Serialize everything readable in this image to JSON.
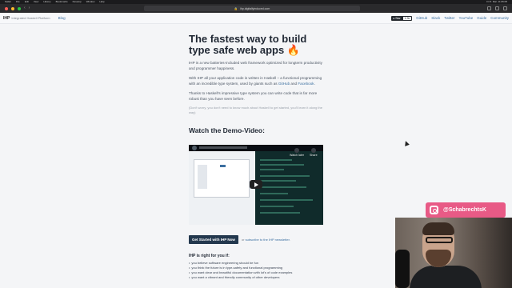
{
  "menubar": {
    "items": [
      "Safari",
      "File",
      "Edit",
      "View",
      "History",
      "Bookmarks",
      "Develop",
      "Window",
      "Help"
    ],
    "clock": "Fri 5. Mar. 11:05:05"
  },
  "browser": {
    "url": "ihp.digitallyinduced.com"
  },
  "site": {
    "brand_mark": "IHP",
    "brand_tagline": "Integrated Haskell Platform",
    "blog": "Blog",
    "star_label": "Star",
    "star_count": "1,3k",
    "nav": [
      "GitHub",
      "Slack",
      "Twitter",
      "YouTube",
      "Guide",
      "Community"
    ]
  },
  "hero": {
    "headline_line1": "The fastest way to build",
    "headline_line2": "type safe web apps",
    "emoji": "🔥",
    "p1": "IHP is a new batteries-included web framework optimized for longterm productivity and programmer happiness.",
    "p2_before": "With IHP all your application code is written in Haskell – a functional programming with an incredible type system, used by giants such as ",
    "p2_github": "GitHub",
    "p2_and": " and ",
    "p2_facebook": "Facebook",
    "p2_end": ".",
    "p3": "Thanks to Haskell's impressive type system you can write code that is far more robust than you have seen before.",
    "note": "(Don't worry, you don't need to know much about Haskell to get started, you'll learn it along the way)",
    "watch": "Watch the Demo-Video:"
  },
  "video": {
    "watch_later": "Watch later",
    "share": "Share"
  },
  "cta": {
    "button": "Get Started with IHP Now",
    "or": "or ",
    "subscribe": "subscribe to the IHP newsletter",
    "end": "."
  },
  "fit": {
    "heading": "IHP is right for you if:",
    "items": [
      "you believe software engineering should be fun",
      "you think the future is in type-safety and functional programming",
      "you want clear and beautiful documentation with lot's of code examples",
      "you want a vibrant and friendly community of other developers"
    ]
  },
  "overlay": {
    "handle": "@SchabrechtsK",
    "brand_color": "#e85a86"
  }
}
